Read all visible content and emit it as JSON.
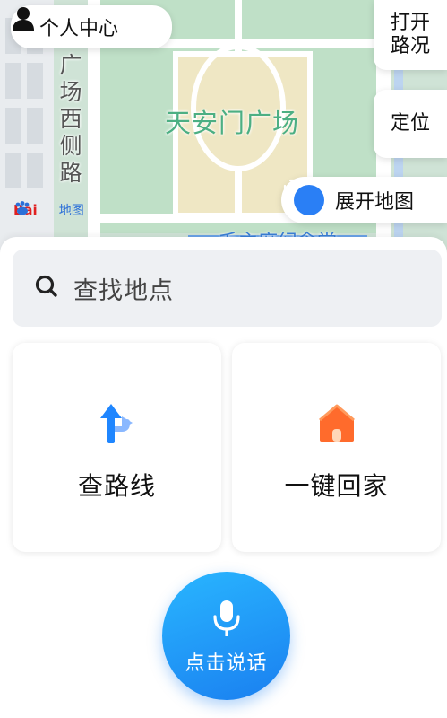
{
  "map": {
    "poi_label": "天安门广场",
    "road_label": "广场西侧路",
    "bottom_label": "毛主席纪念堂",
    "logo_text_1": "Bai",
    "logo_text_2": "地图"
  },
  "header": {
    "profile_label": "个人中心"
  },
  "map_controls": {
    "traffic_label": "打开\n路况",
    "locate_label": "定位",
    "expand_label": "展开地图"
  },
  "search": {
    "placeholder": "查找地点"
  },
  "cards": {
    "route_label": "查路线",
    "home_label": "一键回家"
  },
  "voice": {
    "label": "点击说话"
  },
  "colors": {
    "accent": "#1a7ff0",
    "home_icon": "#ff6b2c",
    "poi_text": "#4caf83"
  }
}
